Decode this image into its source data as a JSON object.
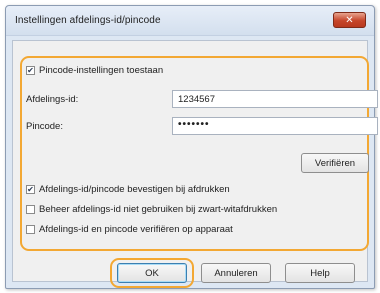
{
  "window": {
    "title": "Instellingen afdelings-id/pincode",
    "close_glyph": "✕"
  },
  "options": {
    "allow_pin": {
      "label": "Pincode-instellingen toestaan",
      "checked": true
    },
    "confirm_on_print": {
      "label": "Afdelings-id/pincode bevestigen bij afdrukken",
      "checked": true
    },
    "bw_printing": {
      "label": "Beheer afdelings-id niet gebruiken bij zwart-witafdrukken",
      "checked": false
    },
    "verify_on_device": {
      "label": "Afdelings-id en pincode verifiëren op apparaat",
      "checked": false
    }
  },
  "fields": {
    "department_id": {
      "label": "Afdelings-id:",
      "value": "1234567"
    },
    "pin": {
      "label": "Pincode:",
      "value": "•••••••"
    }
  },
  "buttons": {
    "verify": "Verifiëren",
    "ok": "OK",
    "cancel": "Annuleren",
    "help": "Help"
  },
  "colors": {
    "highlight": "#f3a833",
    "titlebar": "#dde7f3",
    "close_button": "#c6452a"
  }
}
